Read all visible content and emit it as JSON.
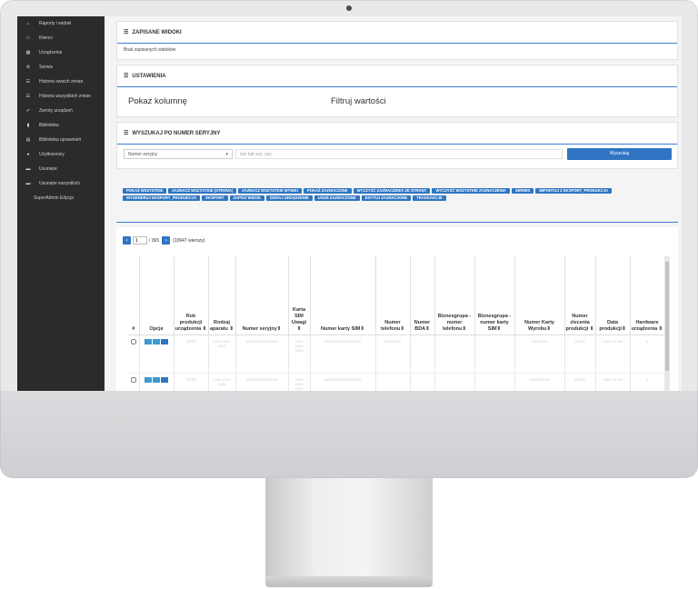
{
  "sidebar": {
    "items": [
      {
        "label": "Raporty i widoki",
        "icon": "home-icon",
        "glyph": "⌂"
      },
      {
        "label": "Klienci",
        "icon": "people-icon",
        "glyph": "⚇"
      },
      {
        "label": "Urządzenia",
        "icon": "grid-icon",
        "glyph": "▦"
      },
      {
        "label": "Serwis",
        "icon": "gear-icon",
        "glyph": "⚙"
      },
      {
        "label": "Historia swoich zmian",
        "icon": "list-icon",
        "glyph": "☰"
      },
      {
        "label": "Historia wszystkich zmian",
        "icon": "list-icon",
        "glyph": "☰"
      },
      {
        "label": "Zwroty urządzeń",
        "icon": "check-icon",
        "glyph": "✔"
      },
      {
        "label": "Biblioteka",
        "icon": "book-icon",
        "glyph": "▮"
      },
      {
        "label": "Biblioteka uprawnień",
        "icon": "table-icon",
        "glyph": "▤"
      },
      {
        "label": "Użytkownicy",
        "icon": "user-icon",
        "glyph": "●"
      },
      {
        "label": "Usunięte",
        "icon": "trash-icon",
        "glyph": "▬"
      },
      {
        "label": "Usunięte wszystkich",
        "icon": "trash-icon",
        "glyph": "▬"
      }
    ],
    "footer": "SuperAdmin Edycja"
  },
  "saved_views": {
    "title": "ZAPISANE WIDOKI",
    "empty_text": "Brak zapisanych widoków"
  },
  "settings": {
    "title": "USTAWIENIA",
    "show_columns": "Pokaż kolumnę",
    "filter_values": "Filtruj wartości"
  },
  "serial_search": {
    "title": "WYSZUKAJ PO NUMER SERYJNY",
    "select_value": "Numer seryjny",
    "input_placeholder": "xxx lub xxx, yyy",
    "button": "Wyszukaj"
  },
  "toolbar": {
    "buttons": [
      "POKAŻ WSZYSTKIE",
      "ZAZNACZ WSZYSTKIE (STRONA)",
      "ZAZNACZ WSZYSTKIE WYNIKI",
      "POKAŻ ZAZNACZONE",
      "WYCZYŚĆ ZAZNACZENIA ZE STRONY",
      "WYCZYŚĆ WSZYSTKIE ZAZNACZENIA",
      "SERWIS",
      "IMPORTUJ Z EKSPORT_PRODUKCJA",
      "WYGENERUJ EKSPORT_PRODUKCJA",
      "EKSPORT",
      "ZAPISZ WIDOK",
      "DODAJ URZĄDZENIE",
      "USUŃ ZAZNACZONE",
      "EDYTUJ ZAZNACZONE",
      "TRANSAKCJE"
    ]
  },
  "pagination": {
    "current": "1",
    "total": "/ 365",
    "rows": "(10947 wierszy)"
  },
  "table": {
    "columns": [
      "#",
      "Opcje",
      "Rok produkcji urządzenia ⇕",
      "Rodzaj aparatu ⇕",
      "Numer seryjny⇕",
      "Karta SIM Uwagi ⇕",
      "Numer karty SIM⇕",
      "Numer telefonu⇕",
      "Numer BDA⇕",
      "Biznesgrupa - numer telefonu⇕",
      "Biznesgrupa - numer karty SIM⇕",
      "Numer Karty Wyrobu⇕",
      "Numer zlecenia produkcji ⇕",
      "Data produkcji⇕",
      "Hardware urządzenia ⇕"
    ],
    "rows": [
      [
        "",
        "",
        "2015",
        "xxxx xxxx xxxx",
        "xxxxxxxxxxxxxxx",
        "xxxx xxxx xxxx",
        "xxxxxxxxxxxxxxxxxx",
        "xxxxxxxx",
        "",
        "",
        "",
        "xxxxxxxx",
        "xxxxx",
        "xxxx-xx-xx",
        "x"
      ],
      [
        "",
        "",
        "2015",
        "xxxx xxxx xxxx",
        "xxxxxxxxxxxxxxx",
        "xxxx xxxx xxxx",
        "xxxxxxxxxxxxxxxxxx",
        "",
        "",
        "",
        "",
        "xxxxxxxxxx",
        "xxxxx",
        "xxxx-xx-xx",
        "x"
      ]
    ]
  },
  "colors": {
    "accent": "#2f75c3",
    "sidebar_bg": "#2b2b2b",
    "panel_line": "#3b7dd8"
  }
}
